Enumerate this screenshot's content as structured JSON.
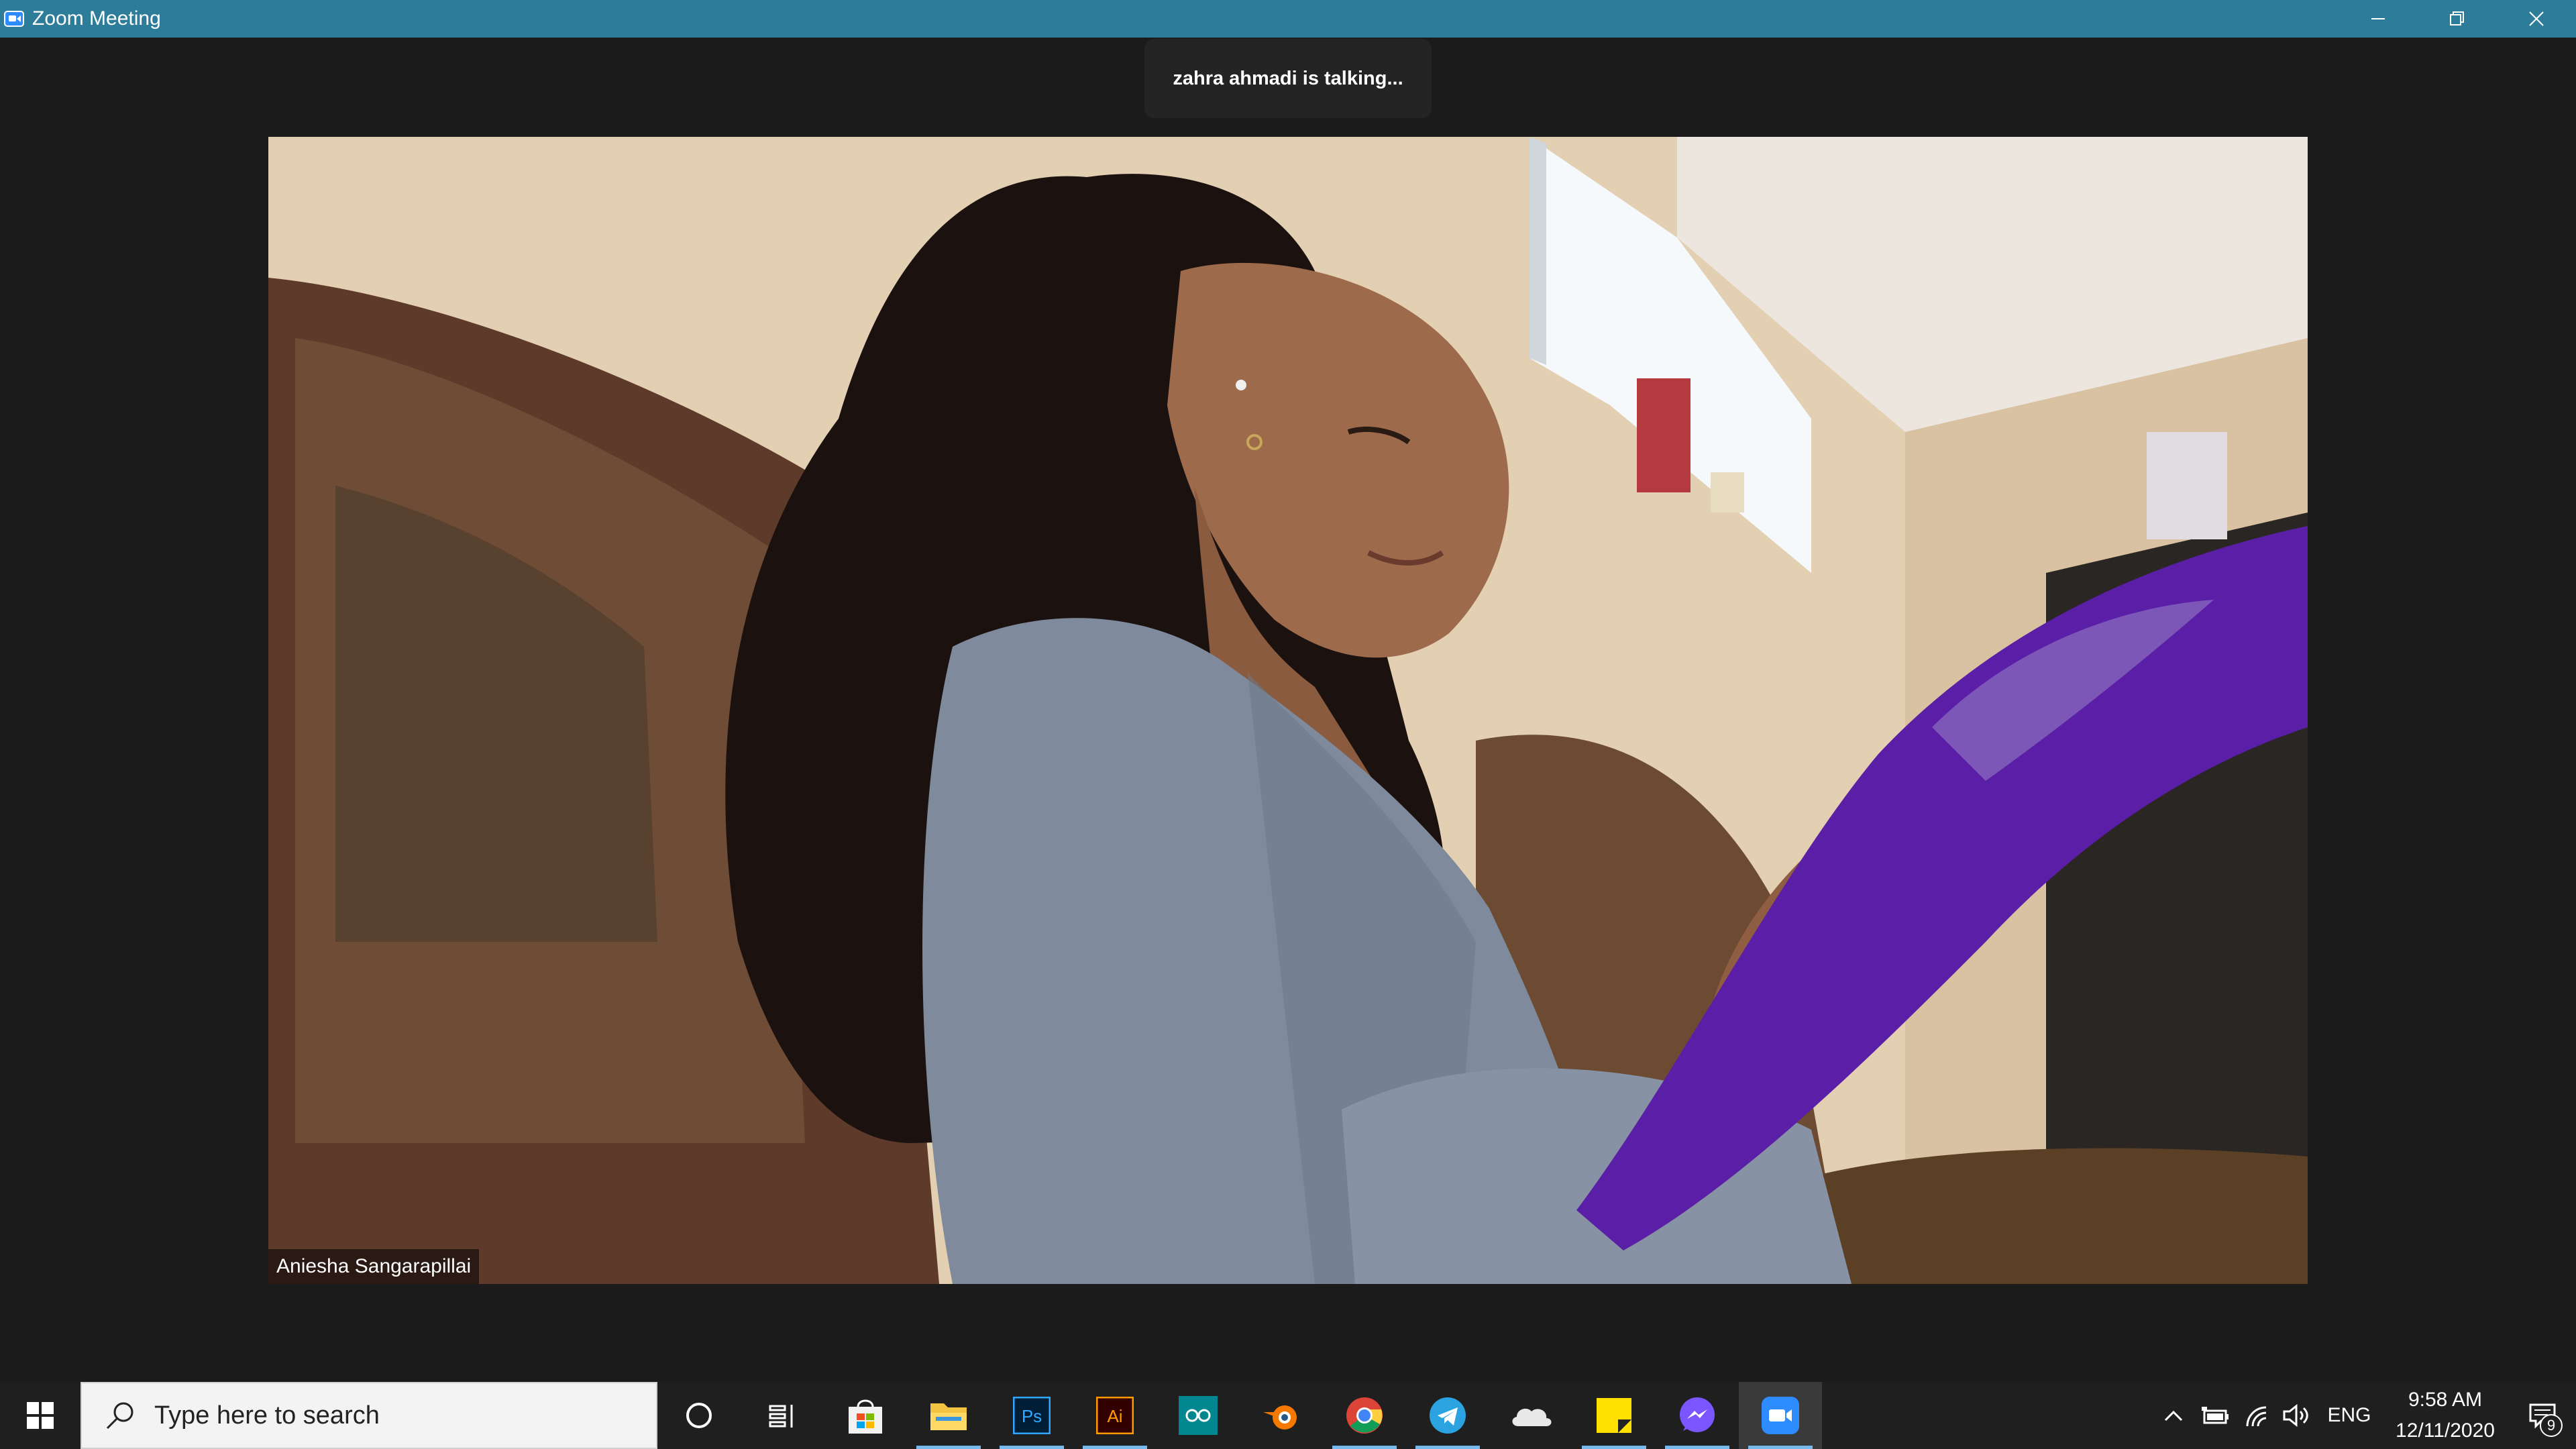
{
  "window": {
    "title": "Zoom Meeting",
    "minimize_label": "Minimize",
    "restore_label": "Restore Down",
    "close_label": "Close"
  },
  "meeting": {
    "speaker_indicator": "zahra ahmadi is talking...",
    "participant_name": "Aniesha Sangarapillai"
  },
  "taskbar": {
    "search_placeholder": "Type here to search",
    "apps": [
      {
        "icon": "cortana-icon"
      },
      {
        "icon": "task-view-icon"
      },
      {
        "icon": "microsoft-store-icon"
      },
      {
        "icon": "file-explorer-icon"
      },
      {
        "icon": "photoshop-icon",
        "label": "Ps"
      },
      {
        "icon": "illustrator-icon",
        "label": "Ai"
      },
      {
        "icon": "arduino-icon"
      },
      {
        "icon": "blender-icon"
      },
      {
        "icon": "chrome-icon"
      },
      {
        "icon": "telegram-icon"
      },
      {
        "icon": "onedrive-icon"
      },
      {
        "icon": "sticky-notes-icon"
      },
      {
        "icon": "messenger-icon"
      },
      {
        "icon": "zoom-icon"
      }
    ],
    "tray": {
      "language": "ENG",
      "time": "9:58 AM",
      "date": "12/11/2020",
      "notification_count": "9"
    }
  },
  "colors": {
    "titlebar": "#2d7d9a",
    "meeting_bg": "#1b1b1b",
    "taskbar_bg": "#1f1f1f",
    "zoom_blue": "#2d8cff"
  }
}
